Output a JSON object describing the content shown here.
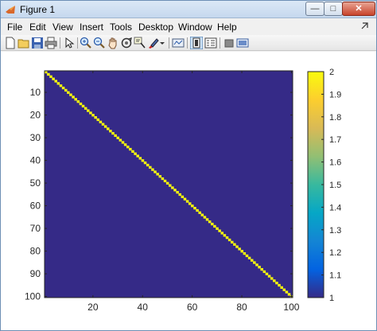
{
  "window": {
    "title": "Figure 1",
    "minimize_glyph": "—",
    "maximize_glyph": "□",
    "close_glyph": "✕"
  },
  "menu": [
    "File",
    "Edit",
    "View",
    "Insert",
    "Tools",
    "Desktop",
    "Window",
    "Help"
  ],
  "toolbar": {
    "buttons": [
      "new-figure-icon",
      "open-file-icon",
      "save-icon",
      "print-icon",
      "edit-plot-arrow-icon",
      "zoom-in-icon",
      "zoom-out-icon",
      "pan-hand-icon",
      "rotate-3d-icon",
      "data-cursor-icon",
      "brush-icon",
      "link-plot-icon",
      "colorbar-icon",
      "legend-icon",
      "hide-plot-tools-icon",
      "show-plot-tools-icon"
    ]
  },
  "colors": {
    "background_cell": "#352a87",
    "diagonal_cell": "#f9fb0e",
    "axes_line": "#262626"
  },
  "chart_data": {
    "type": "heatmap",
    "description_of_values": "identity-like matrix: diagonal = 2, off-diagonal = 1",
    "size": [
      100,
      100
    ],
    "diagonal_value": 2,
    "off_diagonal_value": 1,
    "x_ticks": [
      20,
      40,
      60,
      80,
      100
    ],
    "y_ticks": [
      10,
      20,
      30,
      40,
      50,
      60,
      70,
      80,
      90,
      100
    ],
    "x_tick_labels": [
      "20",
      "40",
      "60",
      "80",
      "100"
    ],
    "y_tick_labels": [
      "10",
      "20",
      "30",
      "40",
      "50",
      "60",
      "70",
      "80",
      "90",
      "100"
    ],
    "xlim": [
      0.5,
      100.5
    ],
    "ylim": [
      0.5,
      100.5
    ],
    "colorbar": {
      "range": [
        1,
        2
      ],
      "tick_labels": [
        "1",
        "1.1",
        "1.2",
        "1.3",
        "1.4",
        "1.5",
        "1.6",
        "1.7",
        "1.8",
        "1.9",
        "2"
      ],
      "ticks": [
        1,
        1.1,
        1.2,
        1.3,
        1.4,
        1.5,
        1.6,
        1.7,
        1.8,
        1.9,
        2
      ],
      "colormap": "parula",
      "colormap_stops": [
        "#352a87",
        "#0363e1",
        "#1485d4",
        "#06a7c6",
        "#38b99e",
        "#92bf73",
        "#d9ba56",
        "#fcce2e",
        "#f9fb0e"
      ]
    }
  }
}
